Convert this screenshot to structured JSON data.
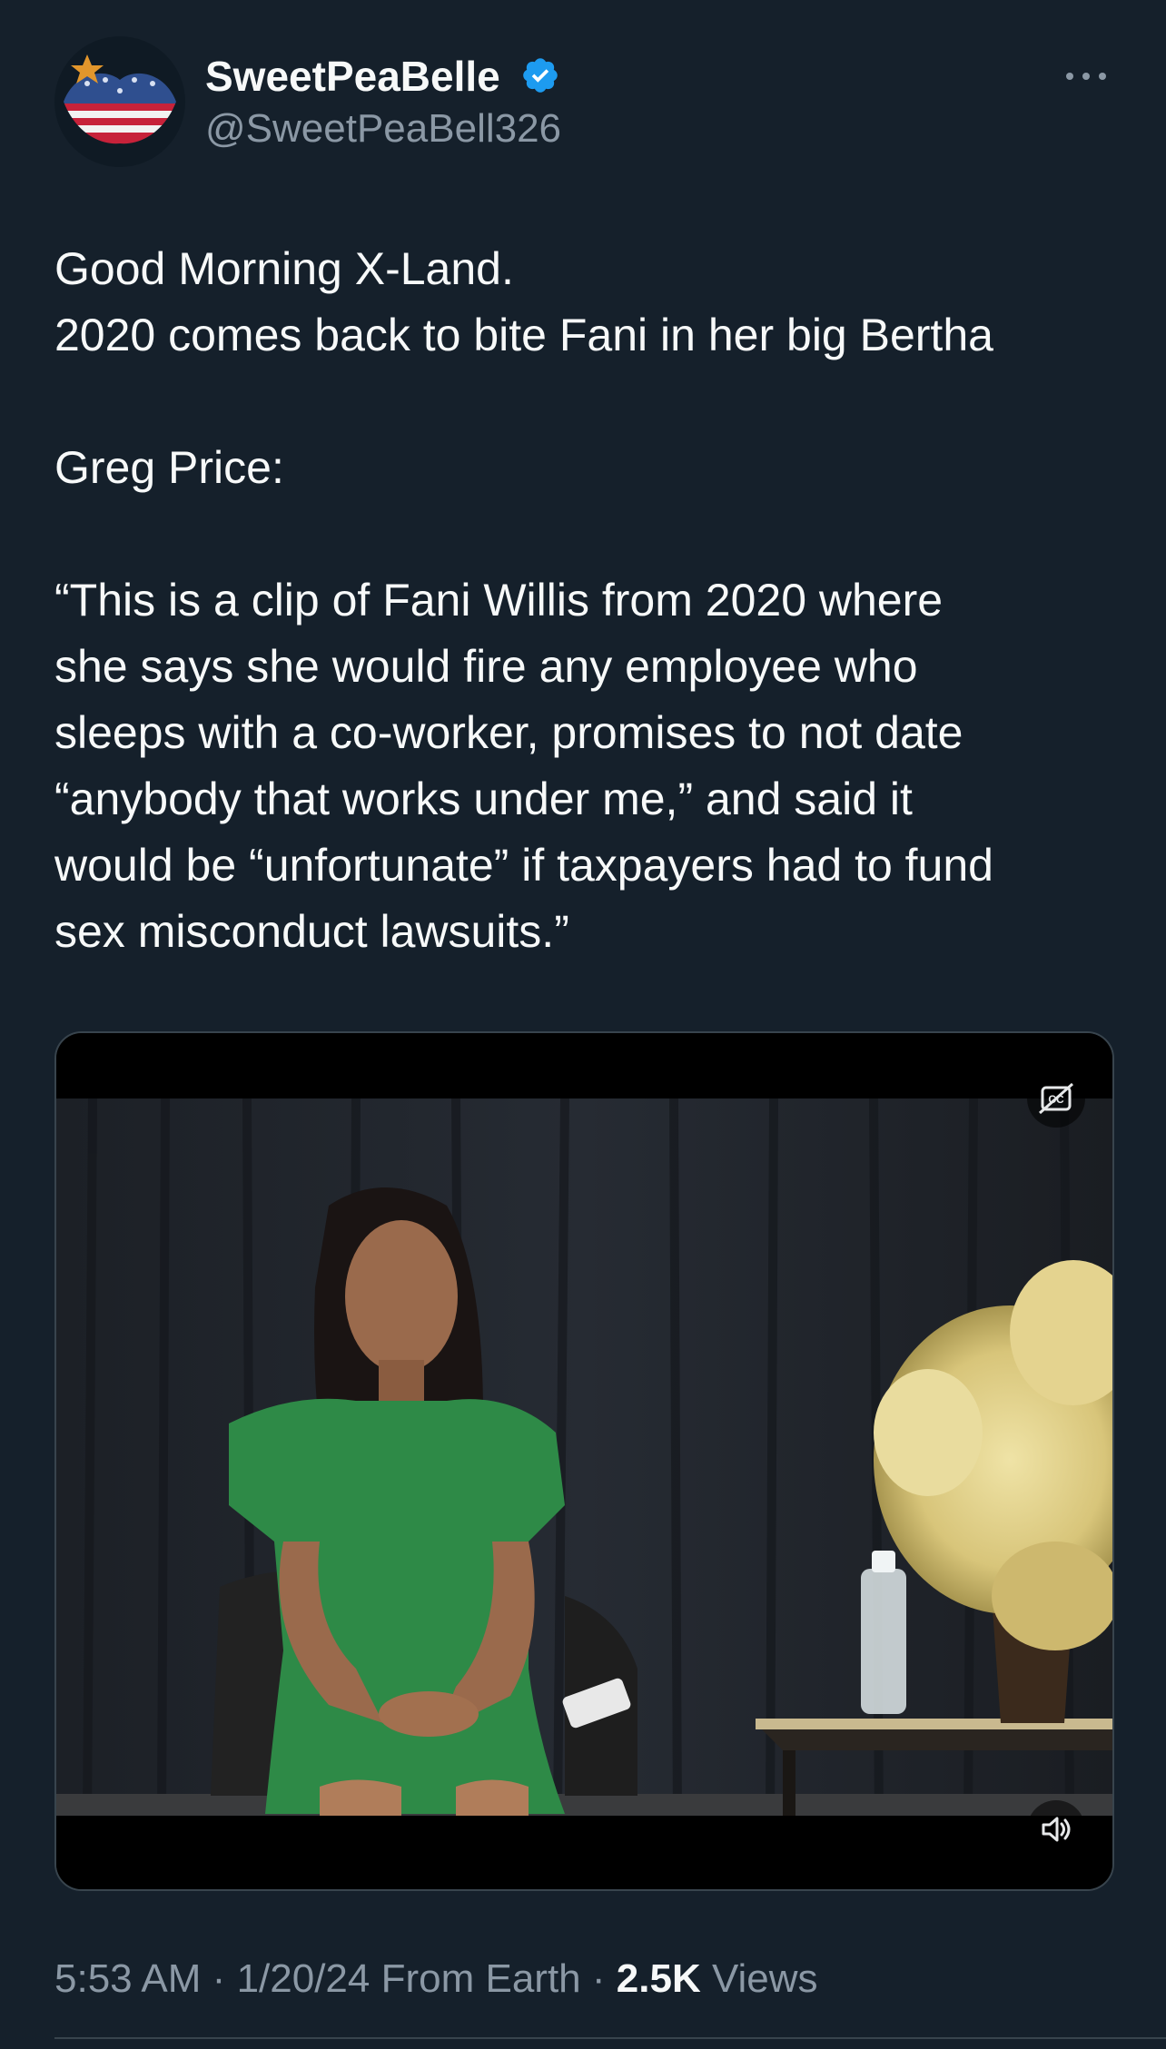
{
  "post": {
    "author": {
      "display_name": "SweetPeaBelle",
      "handle": "@SweetPeaBell326",
      "verified": true,
      "verified_color": "#1d9bf0"
    },
    "text_lines": [
      "Good Morning X-Land.",
      "2020 comes back to bite Fani in her big Bertha",
      "",
      "Greg Price:",
      "",
      "“This is a clip of Fani Willis from 2020 where",
      "she says she would fire any employee who",
      "sleeps with a co-worker, promises to not date",
      "“anybody that works under me,” and said it",
      "would be “unfortunate” if taxpayers had to fund",
      "sex misconduct lawsuits.”"
    ],
    "media": {
      "type": "video",
      "captions_icon": "closed-captions-icon",
      "volume_icon": "volume-icon"
    },
    "meta": {
      "time": "5:53 AM",
      "separator": "·",
      "date": "1/20/24",
      "source": "From Earth",
      "views_count": "2.5K",
      "views_label": "Views"
    }
  },
  "icons": {
    "more": "more-horizontal-icon",
    "verified": "verified-badge-icon"
  },
  "colors": {
    "background": "#15202b",
    "text_primary": "#f7f9f9",
    "text_secondary": "#8b98a5",
    "border": "#38444d"
  }
}
